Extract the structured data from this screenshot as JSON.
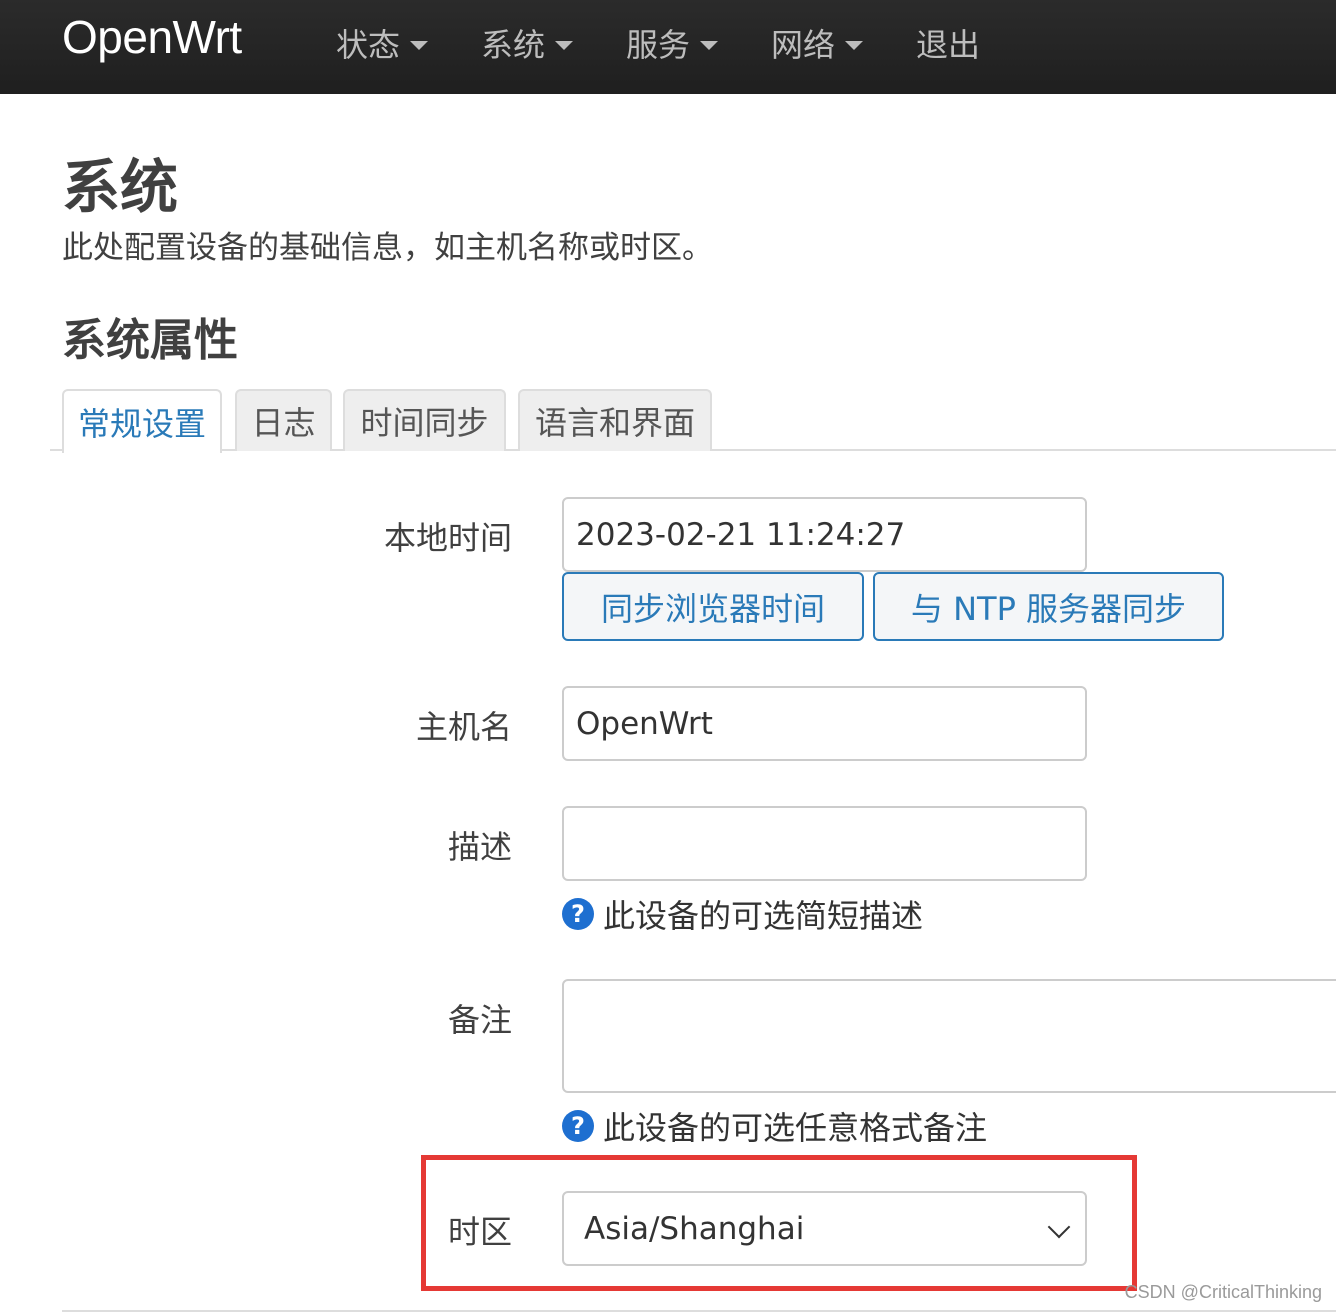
{
  "header": {
    "brand": "OpenWrt",
    "nav": [
      {
        "label": "状态",
        "has_dropdown": true
      },
      {
        "label": "系统",
        "has_dropdown": true
      },
      {
        "label": "服务",
        "has_dropdown": true
      },
      {
        "label": "网络",
        "has_dropdown": true
      },
      {
        "label": "退出",
        "has_dropdown": false
      }
    ]
  },
  "page": {
    "title": "系统",
    "description": "此处配置设备的基础信息，如主机名称或时区。",
    "section_title": "系统属性"
  },
  "tabs": [
    {
      "label": "常规设置",
      "active": true
    },
    {
      "label": "日志",
      "active": false
    },
    {
      "label": "时间同步",
      "active": false
    },
    {
      "label": "语言和界面",
      "active": false
    }
  ],
  "form": {
    "local_time": {
      "label": "本地时间",
      "value": "2023-02-21 11:24:27",
      "sync_browser_button": "同步浏览器时间",
      "sync_ntp_button": "与 NTP 服务器同步"
    },
    "hostname": {
      "label": "主机名",
      "value": "OpenWrt"
    },
    "description": {
      "label": "描述",
      "value": "",
      "help": "此设备的可选简短描述"
    },
    "notes": {
      "label": "备注",
      "value": "",
      "help": "此设备的可选任意格式备注"
    },
    "timezone": {
      "label": "时区",
      "selected": "Asia/Shanghai"
    }
  },
  "help_icon_glyph": "?",
  "colors": {
    "topbar": "#222222",
    "accent": "#2a7ab8",
    "help_icon": "#1e6fd0",
    "highlight": "#e53935"
  },
  "watermark": "CSDN @CriticalThinking"
}
